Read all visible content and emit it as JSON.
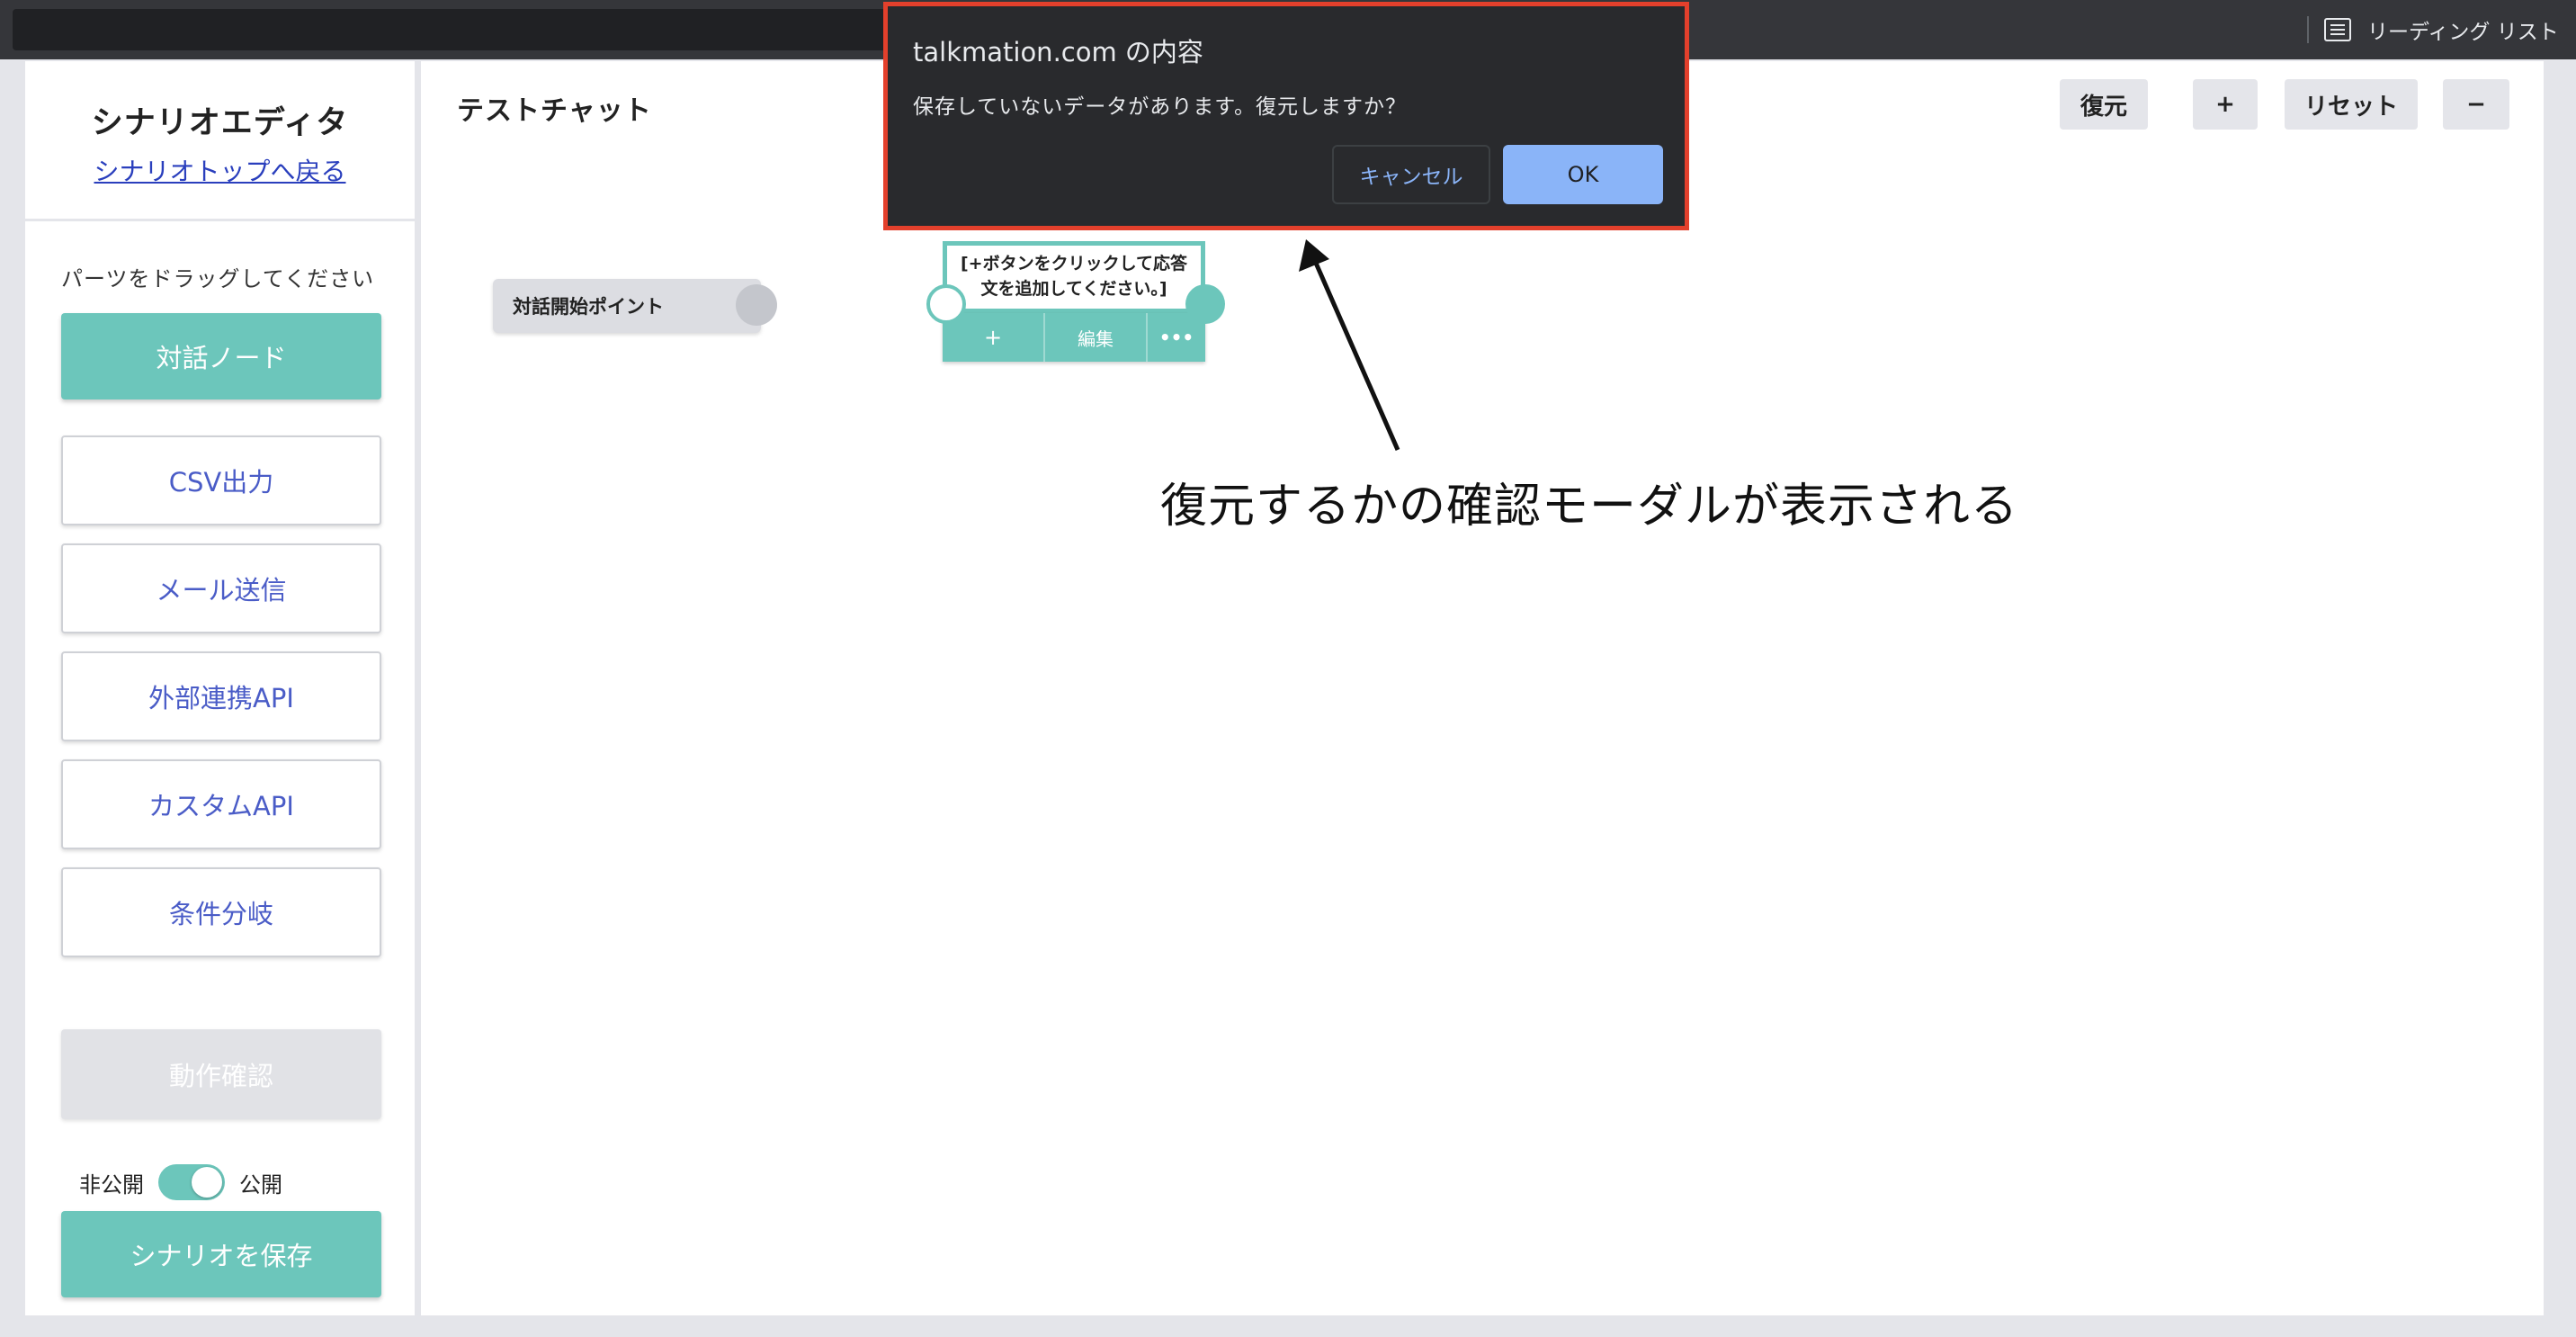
{
  "browser": {
    "reading_list_label": "リーディング リスト"
  },
  "sidebar": {
    "title": "シナリオエディタ",
    "back_link": "シナリオトップへ戻る",
    "hint": "パーツをドラッグしてください",
    "parts": {
      "dialog_node": "対話ノード",
      "csv_output": "CSV出力",
      "mail_send": "メール送信",
      "external_api": "外部連携API",
      "custom_api": "カスタムAPI",
      "branch": "条件分岐"
    },
    "test_run": "動作確認",
    "toggle": {
      "off_label": "非公開",
      "on_label": "公開",
      "state": "on"
    },
    "save_button": "シナリオを保存"
  },
  "canvas": {
    "title": "テストチャット",
    "toolbar": {
      "restore": "復元",
      "zoom_in": "+",
      "reset": "リセット",
      "zoom_out": "−"
    },
    "start_node": {
      "label": "対話開始ポイント"
    },
    "dialog_node": {
      "text": "[+ボタンをクリックして応答文を追加してください。]",
      "add": "+",
      "edit": "編集",
      "more": "•••"
    }
  },
  "annotation": {
    "text": "復元するかの確認モーダルが表示される"
  },
  "modal": {
    "title": "talkmation.com の内容",
    "message": "保存していないデータがあります。復元しますか？",
    "cancel": "キャンセル",
    "ok": "OK",
    "border_color": "#e3402c"
  },
  "colors": {
    "accent": "#6cc6bb",
    "link": "#2a3fbd",
    "outline_text": "#4a5cc7",
    "modal_bg": "#292a2d",
    "modal_ok": "#8ab4f8"
  }
}
